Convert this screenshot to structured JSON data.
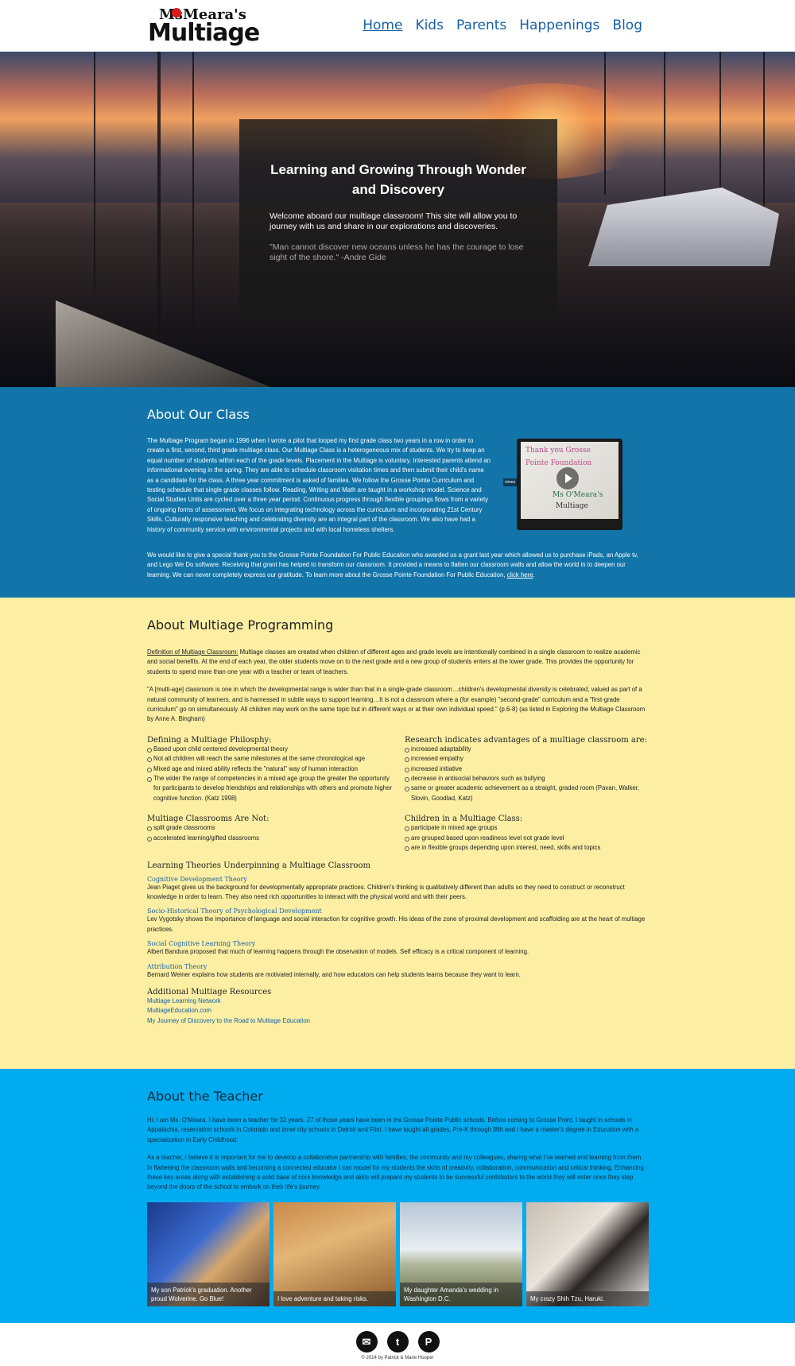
{
  "logo": {
    "ms": "Ms",
    "meara": "Meara's",
    "multiage": "Multiage"
  },
  "nav": [
    {
      "label": "Home"
    },
    {
      "label": "Kids"
    },
    {
      "label": "Parents"
    },
    {
      "label": "Happenings"
    },
    {
      "label": "Blog"
    }
  ],
  "hero": {
    "title": "Learning and Growing Through Wonder and Discovery",
    "welcome": "Welcome aboard our multiage classroom! This site will allow you to journey with us and share in our explorations and discoveries.",
    "quote": "\"Man cannot discover new oceans unless he has the courage to lose sight of the shore.\" -Andre Gide"
  },
  "about_class": {
    "title": "About Our Class",
    "body": "The Multiage Program began in 1996 when I wrote a pilot that looped my first grade class two years in a row in order to create a first, second, third grade multiage class. Our Multiage Class is a heterogeneous mix of students. We try to keep an equal number of students within each of the grade levels. Placement in the Multiage is voluntary. Interested parents attend an informational evening in the spring. They are able to schedule classroom visitation times and then submit their child's name as a candidate for the class. A three year commitment is asked of families. We follow the Grosse Pointe Curriculum and testing schedule that single grade classes follow. Reading, Writing and Math are taught in a workshop model. Science and Social Studies Units are cycled over a three year period. Continuous progress through flexible groupings flows from a variety of ongoing forms of assessment. We focus on integrating technology across the curriculum and incorporating 21st Century Skills. Culturally responsive teaching and celebrating diversity are an integral part of the classroom. We also have had a history of community service with environmental projects and with local homeless shelters.",
    "video_tag": "vimeo",
    "video_text_1": "Thank you Grosse",
    "video_text_2": "Pointe Foundation",
    "video_text_3": "Ms O'Meara's",
    "video_text_4": "Multiage",
    "thanks": "We would like to give a special thank you to the Grosse Pointe Foundation For Public Education who awarded us a grant last year which allowed us to purchase iPads, an Apple tv, and Lego We Do software. Receiving that grant has helped to transform our classroom. It provided a means to flatten our classroom walls and allow the world in to deepen our learning. We can never completely express our gratitude.  To learn more about the Grosse Pointe Foundation For Public Education,",
    "thanks_link": "click here"
  },
  "multiage": {
    "title": "About Multiage Programming",
    "definition_label": "Definition of Multiage Classroom:",
    "definition": " Multiage classes are created when children of different ages and grade levels are intentionally combined in a single classroom to realize academic and social benefits. At the end of each year, the older students move on to the next grade and a new group of students enters at the lower grade. This provides the opportunity for students to spend more than one year with a teacher or team of teachers.",
    "quote": "\"A [multi-age] classroom is one in which the developmental range is wider than that in a single-grade classroom…children's developmental diversity is celebrated, valued as part of a natural community of learners, and is harnessed in subtle ways to support learning…It is not a classroom where a (for example) \"second-grade\" curriculum and a \"first-grade curriculum\" go on simultaneously. All children may work on the same topic but in different ways or at their own individual speed.\" (p.6-8) (as listed in Exploring the Multiage Classroom by Anne A. Bingham)",
    "philosophy_title": "Defining a Multiage Philosphy:",
    "philosophy": [
      "Based upon child centered developmental theory",
      "Not all children will reach the same milestones at the same chronological age",
      "Mixed age and mixed ability reflects the \"natural\" way of human interaction",
      "The wider the range of competencies in a mixed age group the greater the opportunity for participants to develop friendships and relationships with others and promote higher cognitive function. (Katz 1998)"
    ],
    "research_title": "Research indicates advantages of a multiage classroom are:",
    "research": [
      "increased adaptability",
      "increased empathy",
      "increased initiative",
      "decrease in antisocial behaviors such as bullying",
      "same or greater academic achievement as a straight, graded room (Pavan, Walker, Slovin, Goodlad, Katz)"
    ],
    "not_title": "Multiage Classrooms Are Not:",
    "not": [
      "split grade classrooms",
      "accelerated learning/gifted classrooms"
    ],
    "children_title": "Children in a Multiage Class:",
    "children": [
      "participate in mixed age groups",
      "are grouped based upon readiness level not grade level",
      "are in flexible groups depending upon interest, need, skills and topics"
    ],
    "theories_title": "Learning Theories Underpinning a Multiage Classroom",
    "theories": [
      {
        "name": "Cognitive Development Theory",
        "text": "Jean Piaget gives us the background for developmentally appropriate practices. Children's thinking is qualitatively different than adults so they need to construct or reconstruct knowledge in order to learn. They also need rich opportunities to interact with the physical world and with their peers."
      },
      {
        "name": "Socio-Historical Theory of Psychological Development",
        "text": "Lev Vygotsky shows the importance of language and social interaction for cognitive growth. His ideas of the zone of proximal development and scaffolding are at the heart of multiage practices."
      },
      {
        "name": "Social Cognitive Learning Theory",
        "text": "Albert Bandura proposed that much of learning happens through the observation of models. Self efficacy is a critical component of learning."
      },
      {
        "name": "Attribution Theory",
        "text": "Bernard Weiner explains how students are motivated internally, and how educators can help students learns because they want to learn."
      }
    ],
    "resources_title": "Additional Multiage Resources",
    "resources": [
      "Multiage Learning Network",
      "MultiageEducation.com",
      "My Journey of Discovery to the Road to Multiage Education"
    ]
  },
  "teacher": {
    "title": "About the Teacher",
    "p1": "Hi, I am Ms. O'Meara. I have been a teacher for 32 years. 27 of those years have been in the Grosse Pointe Public schools. Before coming to Grosse Point, I taught in schools in Appalachia, reservation schools in Colorado and inner city schools in Detroit and Flint. I have taught all grades, Pre-K through fifth and I have a master's degree in Education with a specialization in Early Childhood.",
    "p2": "As a teacher, I believe it is important for me to develop a collaborative partnership with families, the community and my colleagues, sharing what I've learned and learning from them. In flattening the classroom walls and becoming a connected educator I can model for my students the skills of creativity, collaboration, communication and critical thinking. Enhancing these key areas along with establishing a solid base of core knowledge and skills will prepare my students to be successful contributors to the world they will enter once they step beyond the doors of the school to embark on their life's journey.",
    "photos": [
      {
        "caption": "My son Patrick's graduation. Another proud Wolverine. Go Blue!"
      },
      {
        "caption": "I love adventure and taking risks."
      },
      {
        "caption": "My daughter Amanda's wedding in Washington D.C."
      },
      {
        "caption": "My crazy Shih Tzu, Haruki."
      }
    ]
  },
  "footer": {
    "copyright": "© 2014 by Patrick & Marie Hooper"
  }
}
